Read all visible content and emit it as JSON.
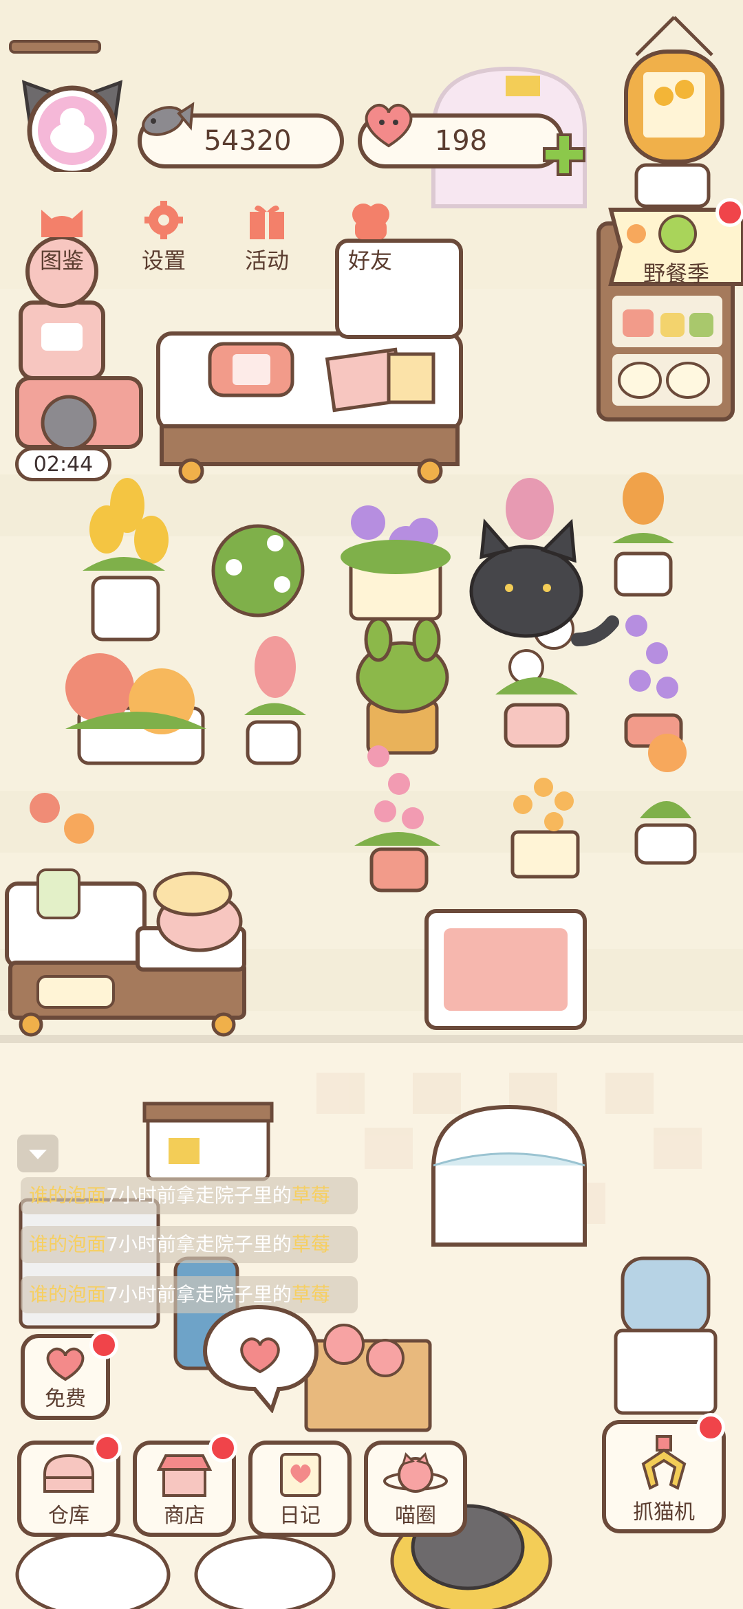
{
  "currency": {
    "coins": "54320",
    "hearts": "198",
    "coin_icon": "fish-icon",
    "heart_icon": "heart-icon",
    "add_icon": "plus-icon"
  },
  "top_menu": [
    {
      "id": "catalog",
      "label": "图鉴",
      "icon": "cat-head-icon"
    },
    {
      "id": "settings",
      "label": "设置",
      "icon": "gear-icon"
    },
    {
      "id": "events",
      "label": "活动",
      "icon": "gift-icon"
    },
    {
      "id": "friends",
      "label": "好友",
      "icon": "friends-icon"
    }
  ],
  "event_banner": {
    "label": "野餐季",
    "has_notification": true
  },
  "timer": {
    "value": "02:44"
  },
  "chat_feed": [
    {
      "user": "谁的泡面",
      "text": "7小时前拿走院子里的",
      "item": "草莓"
    },
    {
      "user": "谁的泡面",
      "text": "7小时前拿走院子里的",
      "item": "草莓"
    },
    {
      "user": "谁的泡面",
      "text": "7小时前拿走院子里的",
      "item": "草莓"
    }
  ],
  "free_button": {
    "label": "免费",
    "icon": "heart-icon",
    "has_notification": true
  },
  "bottom_nav": [
    {
      "id": "storage",
      "label": "仓库",
      "icon": "storage-icon",
      "has_notification": true
    },
    {
      "id": "shop",
      "label": "商店",
      "icon": "shop-icon",
      "has_notification": true
    },
    {
      "id": "diary",
      "label": "日记",
      "icon": "diary-icon",
      "has_notification": false
    },
    {
      "id": "circle",
      "label": "喵圈",
      "icon": "cat-planet-icon",
      "has_notification": false
    }
  ],
  "catch_cat": {
    "label": "抓猫机",
    "icon": "claw-icon",
    "has_notification": true
  },
  "colors": {
    "outline": "#6b4a3a",
    "background": "#f6f0e0",
    "accent_red": "#f0444a",
    "accent_green": "#8cc84b",
    "chat_highlight": "#f6cf62"
  }
}
